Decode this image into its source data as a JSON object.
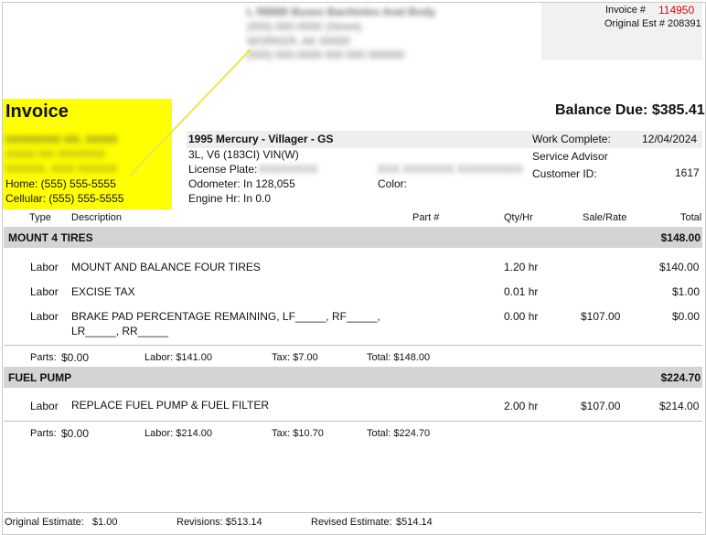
{
  "header": {
    "invoice_label": "Invoice #",
    "invoice_number": "114950",
    "original_est_label": "Original Est #",
    "original_est_number": "208391",
    "shop_blurred_lines": [
      "L RBBB Buses Bachtoles Aval Body",
      "(555) 000-0000 (Street)",
      "WORKER, AK 00000",
      "(555) 000-0000 000 000 000000"
    ]
  },
  "customer": {
    "title": "Invoice",
    "blurred_lines": [
      "RRRRRRR RR. RRRR",
      "00000 RR RRRRRR",
      "RRRRR, RRR RRRRR"
    ],
    "home_phone": "Home: (555) 555-5555",
    "cell_phone": "Cellular: (555) 555-5555"
  },
  "balance_due": "Balance Due: $385.41",
  "vehicle": {
    "name": "1995 Mercury - Villager - GS",
    "engine": "3L, V6 (183CI) VIN(W)",
    "license_label": "License Plate:",
    "license_blur": "XXXXXXXX",
    "vin_blur": "XXX XXXXXXX XXXXXXXXX",
    "odometer": "Odometer: In 128,055",
    "color_label": "Color:",
    "engine_hr": "Engine Hr: In 0.0"
  },
  "work": {
    "complete_label": "Work Complete:",
    "complete_date": "12/04/2024",
    "advisor_label": "Service Advisor",
    "customer_id_label": "Customer ID:",
    "customer_id": "1617"
  },
  "columns": {
    "type": "Type",
    "description": "Description",
    "part": "Part #",
    "qty": "Qty/Hr",
    "rate": "Sale/Rate",
    "total": "Total"
  },
  "jobs": [
    {
      "name": "MOUNT 4 TIRES",
      "total": "$148.00",
      "lines": [
        {
          "type": "Labor",
          "desc": "MOUNT AND BALANCE FOUR TIRES",
          "desc2": "",
          "qty": "1.20 hr",
          "rate": "",
          "total": "$140.00"
        },
        {
          "type": "Labor",
          "desc": "EXCISE TAX",
          "desc2": "",
          "qty": "0.01 hr",
          "rate": "",
          "total": "$1.00"
        },
        {
          "type": "Labor",
          "desc": "BRAKE PAD PERCENTAGE REMAINING, LF_____, RF_____,",
          "desc2": "LR_____, RR_____",
          "qty": "0.00 hr",
          "rate": "$107.00",
          "total": "$0.00"
        }
      ],
      "summary": {
        "parts_label": "Parts:",
        "parts": "$0.00",
        "labor": "Labor: $141.00",
        "tax": "Tax: $7.00",
        "total": "Total: $148.00"
      }
    },
    {
      "name": "FUEL PUMP",
      "total": "$224.70",
      "lines": [
        {
          "type": "Labor",
          "desc": "REPLACE FUEL PUMP & FUEL FILTER",
          "desc2": "",
          "qty": "2.00 hr",
          "rate": "$107.00",
          "total": "$214.00"
        }
      ],
      "summary": {
        "parts_label": "Parts:",
        "parts": "$0.00",
        "labor": "Labor: $214.00",
        "tax": "Tax: $10.70",
        "total": "Total: $224.70"
      }
    }
  ],
  "footer": {
    "original_label": "Original Estimate:",
    "original_value": "$1.00",
    "revisions": "Revisions: $513.14",
    "revised_label": "Revised Estimate:",
    "revised_value": "$514.14"
  },
  "colors": {
    "highlight": "#ffff00",
    "invoice_number": "#ee0000",
    "section_bg": "#d4d4d4"
  }
}
